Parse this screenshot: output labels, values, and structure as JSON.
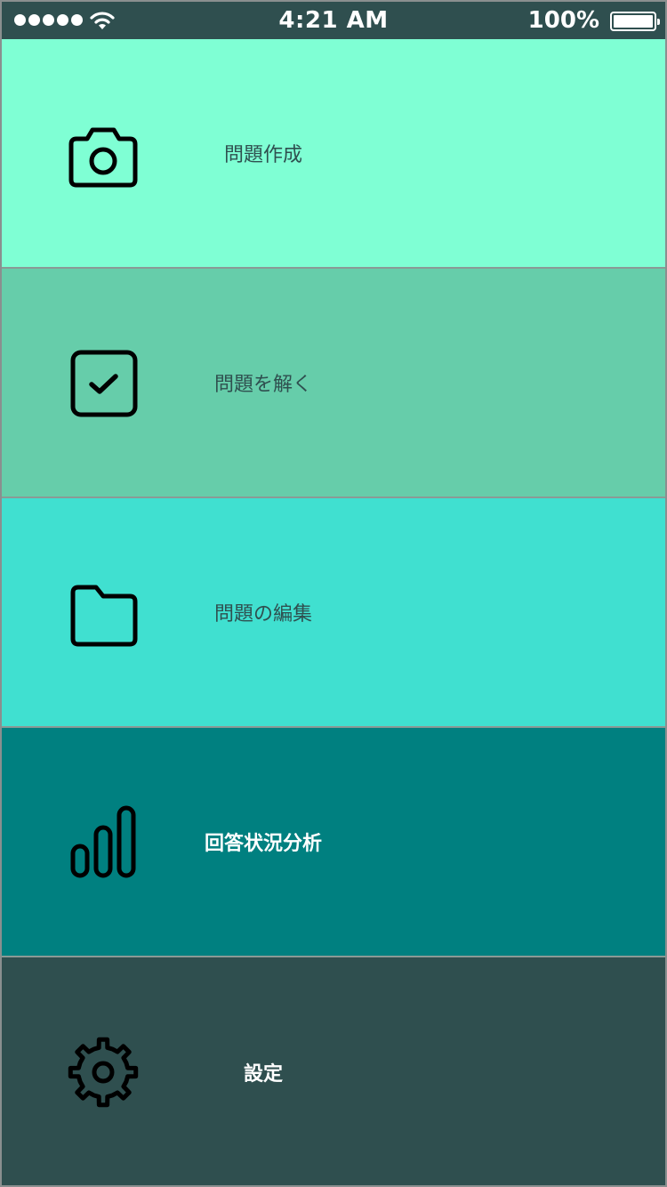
{
  "status_bar": {
    "time": "4:21 AM",
    "battery": "100%",
    "color": "#2f4f4f"
  },
  "menu": {
    "items": [
      {
        "label": "問題作成",
        "icon": "camera-icon",
        "background": "#7fffd4",
        "text_color": "#2f4f4f"
      },
      {
        "label": "問題を解く",
        "icon": "checkbox-icon",
        "background": "#66cdaa",
        "text_color": "#2f4f4f"
      },
      {
        "label": "問題の編集",
        "icon": "folder-icon",
        "background": "#40e0d0",
        "text_color": "#2f4f4f"
      },
      {
        "label": "回答状況分析",
        "icon": "bar-chart-icon",
        "background": "#008080",
        "text_color": "#ffffff"
      },
      {
        "label": "設定",
        "icon": "gear-icon",
        "background": "#2f4f4f",
        "text_color": "#ffffff"
      }
    ]
  }
}
